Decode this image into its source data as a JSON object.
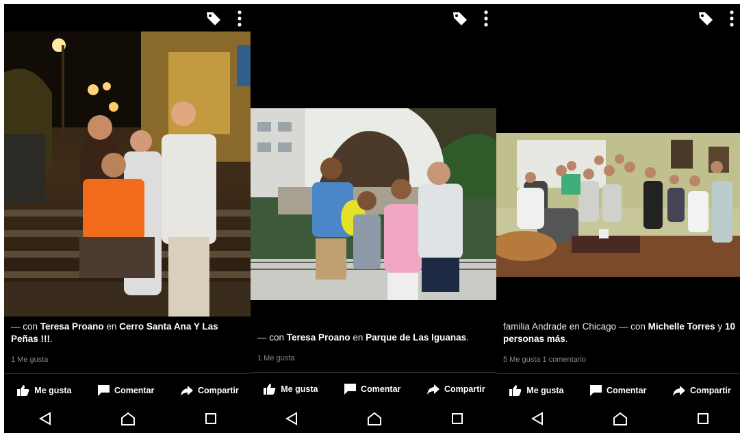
{
  "posts": [
    {
      "caption_prefix": "— con ",
      "tagged": "Teresa Proano",
      "conn": " en ",
      "place": "Cerro Santa Ana Y Las Peñas !!!",
      "tail": ".",
      "likes": "1 Me gusta"
    },
    {
      "caption_prefix": "— con ",
      "tagged": "Teresa Proano",
      "conn": " en ",
      "place": "Parque de Las Iguanas",
      "tail": ".",
      "likes": "1 Me gusta"
    },
    {
      "caption_prefix": "familia Andrade en Chicago — con ",
      "tagged": "Michelle Torres",
      "conn": " y ",
      "place": "10 personas más",
      "tail": ".",
      "likes": "5 Me gusta  1 comentario"
    }
  ],
  "actions": {
    "like": "Me gusta",
    "comment": "Comentar",
    "share": "Compartir"
  },
  "icons": {
    "tag": "tag-icon",
    "menu": "more-vertical-icon",
    "like": "thumbs-up-icon",
    "comment": "comment-icon",
    "share": "share-arrow-icon",
    "back": "back-triangle-icon",
    "home": "home-icon",
    "recents": "recents-square-icon"
  }
}
